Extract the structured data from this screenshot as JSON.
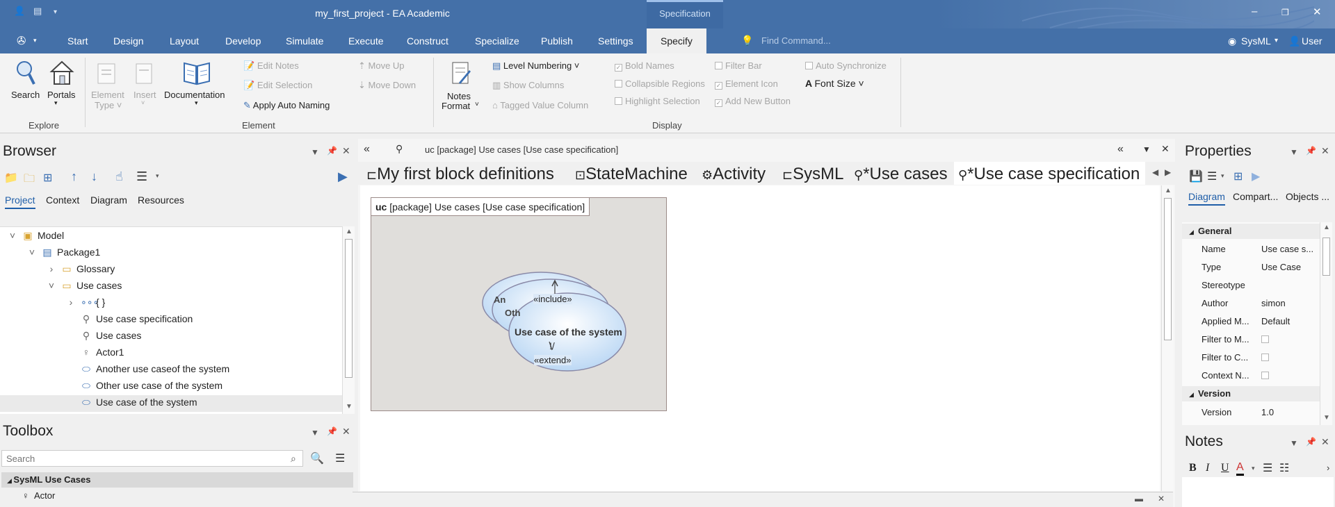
{
  "app": {
    "title": "my_first_project - EA Academic",
    "context_tab": "Specification"
  },
  "menubar": {
    "items": [
      "Start",
      "Design",
      "Layout",
      "Develop",
      "Simulate",
      "Execute",
      "Construct",
      "Specialize",
      "Publish",
      "Settings",
      "Specify"
    ],
    "find": "Find Command...",
    "perspective": "SysML",
    "user": "User"
  },
  "ribbon": {
    "explore": {
      "search": "Search",
      "portals": "Portals",
      "label": "Explore"
    },
    "element": {
      "element_type": "Element Type",
      "insert": "Insert",
      "documentation": "Documentation",
      "edit_notes": "Edit Notes",
      "edit_selection": "Edit Selection",
      "apply_auto_naming": "Apply Auto Naming",
      "move_up": "Move Up",
      "move_down": "Move Down",
      "label": "Element"
    },
    "display": {
      "notes": "Notes",
      "format": "Format",
      "level_numbering": "Level Numbering",
      "show_columns": "Show Columns",
      "tagged_value_column": "Tagged Value Column",
      "bold_names": "Bold Names",
      "collapsible_regions": "Collapsible Regions",
      "highlight_selection": "Highlight Selection",
      "filter_bar": "Filter Bar",
      "element_icon": "Element Icon",
      "add_new_button": "Add New Button",
      "auto_synchronize": "Auto Synchronize",
      "font_size": "Font Size",
      "label": "Display"
    }
  },
  "browser": {
    "title": "Browser",
    "tabs": [
      "Project",
      "Context",
      "Diagram",
      "Resources"
    ],
    "tree": [
      "Model",
      "Package1",
      "Glossary",
      "Use cases",
      "{ }",
      "Use case specification",
      "Use cases",
      "Actor1",
      "Another use caseof the system",
      "Other use case of the system",
      "Use case of the system"
    ]
  },
  "toolbox": {
    "title": "Toolbox",
    "search_placeholder": "Search",
    "group": "SysML Use Cases",
    "item": "Actor"
  },
  "diagram": {
    "path": "uc [package] Use cases [Use case specification]",
    "tabs": [
      "My first block definitions",
      "StateMachine",
      "Activity",
      "SysML",
      "*Use cases",
      "*Use case specification"
    ],
    "frame_label_kw": "uc",
    "frame_label": "[package] Use cases [Use case specification]",
    "usecase_main": "Use case of the system",
    "usecase_a": "An",
    "usecase_b": "Oth",
    "include": "«include»",
    "extend": "«extend»"
  },
  "properties": {
    "title": "Properties",
    "tabs": [
      "Diagram",
      "Compart...",
      "Objects ..."
    ],
    "general": "General",
    "rows": [
      {
        "k": "Name",
        "v": "Use case s..."
      },
      {
        "k": "Type",
        "v": "Use Case"
      },
      {
        "k": "Stereotype",
        "v": ""
      },
      {
        "k": "Author",
        "v": "simon"
      },
      {
        "k": "Applied M...",
        "v": "Default"
      },
      {
        "k": "Filter to M...",
        "v": ""
      },
      {
        "k": "Filter to C...",
        "v": ""
      },
      {
        "k": "Context N...",
        "v": ""
      }
    ],
    "version_group": "Version",
    "version_key": "Version",
    "version_val": "1.0"
  },
  "notes": {
    "title": "Notes"
  }
}
